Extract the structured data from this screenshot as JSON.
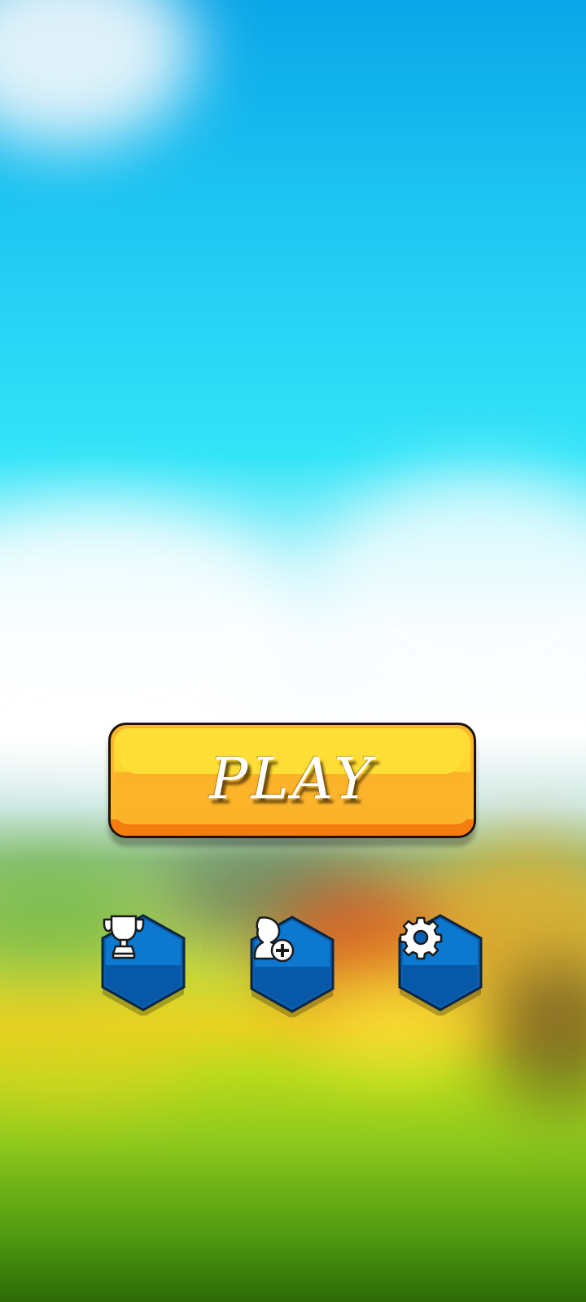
{
  "main_menu": {
    "play_label": "PLAY",
    "buttons": [
      {
        "name": "leaderboard",
        "icon": "trophy-icon"
      },
      {
        "name": "add-player",
        "icon": "user-add-icon"
      },
      {
        "name": "settings",
        "icon": "gear-icon"
      }
    ]
  },
  "colors": {
    "play_button": "#ffd530",
    "play_button_dark": "#f57d10",
    "hex_button": "#0a6fc4",
    "hex_button_dark": "#0853a0"
  }
}
